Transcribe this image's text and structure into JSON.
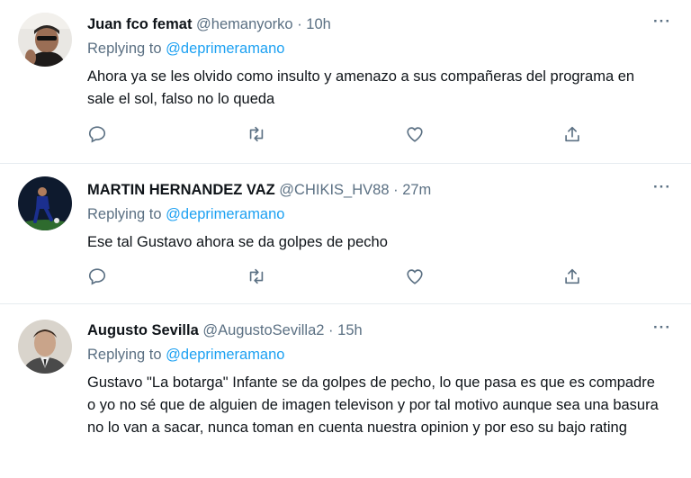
{
  "tweets": [
    {
      "name": "Juan fco femat",
      "handle": "@hemanyorko",
      "separator": "·",
      "time": "10h",
      "replying_prefix": "Replying to",
      "replying_to": "@deprimeramano",
      "text": "Ahora ya se les olvido como insulto y amenazo a sus compañeras del programa en sale el sol, falso no lo queda",
      "more_icon": "more-icon"
    },
    {
      "name": "MARTIN HERNANDEZ VAZ",
      "handle": "@CHIKIS_HV88",
      "separator": "·",
      "time": "27m",
      "replying_prefix": "Replying to",
      "replying_to": "@deprimeramano",
      "text": "Ese tal Gustavo ahora se da golpes de pecho",
      "more_icon": "more-icon"
    },
    {
      "name": "Augusto Sevilla",
      "handle": "@AugustoSevilla2",
      "separator": "·",
      "time": "15h",
      "replying_prefix": "Replying to",
      "replying_to": "@deprimeramano",
      "text": "Gustavo \"La botarga\" Infante se da golpes de pecho, lo que pasa es que es compadre o yo no sé que de alguien de imagen televison y por tal motivo aunque sea una basura no lo van a sacar, nunca toman en cuenta nuestra opinion y por eso su bajo rating",
      "more_icon": "more-icon"
    }
  ],
  "action_icons": [
    "reply-icon",
    "retweet-icon",
    "like-icon",
    "share-icon"
  ],
  "colors": {
    "accent": "#1da1f2",
    "secondary_text": "#5b7083",
    "primary_text": "#0f1419",
    "divider": "#e6ecf0"
  }
}
